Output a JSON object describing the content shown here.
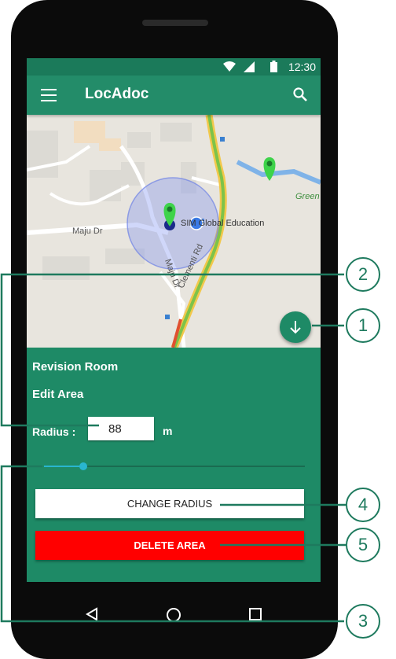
{
  "status_bar": {
    "time": "12:30",
    "icons": [
      "wifi-icon",
      "signal-icon",
      "battery-icon"
    ]
  },
  "app_bar": {
    "title": "LocAdoc",
    "menu_icon": "menu-icon",
    "search_icon": "search-icon"
  },
  "map": {
    "labels": {
      "road1": "Maju Dr",
      "road2": "Maju Dr",
      "road3": "Clementi Rd",
      "poi": "SIM Global Education",
      "park": "Green"
    }
  },
  "panel": {
    "area_name": "Revision Room",
    "section_title": "Edit Area",
    "radius_label": "Radius :",
    "radius_value": "88",
    "radius_unit": "m",
    "slider_value_fraction": 0.15,
    "change_radius_label": "CHANGE RADIUS",
    "delete_area_label": "DELETE AREA"
  },
  "fab": {
    "icon": "arrow-down-icon"
  },
  "nav_bar": {
    "icons": [
      "back-icon",
      "home-icon",
      "recents-icon"
    ]
  },
  "callouts": [
    "1",
    "2",
    "3",
    "4",
    "5"
  ],
  "colors": {
    "primary": "#1e8a66",
    "delete": "#ff0000",
    "accent": "#29b6cf",
    "callout": "#1e7a5e"
  }
}
